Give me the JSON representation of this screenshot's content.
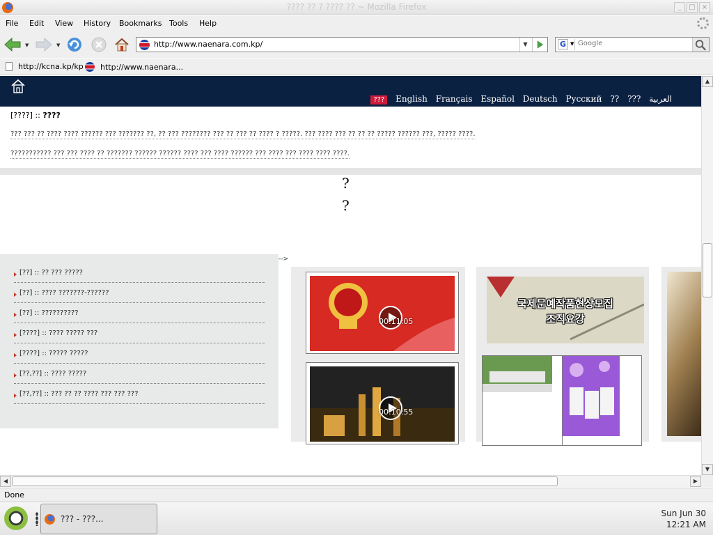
{
  "window": {
    "title": "???? ?? ? ???? ?? ~ Mozilla Firefox"
  },
  "menu": {
    "file": "File",
    "edit": "Edit",
    "view": "View",
    "history": "History",
    "bookmarks": "Bookmarks",
    "tools": "Tools",
    "help": "Help"
  },
  "nav": {
    "url": "http://www.naenara.com.kp/",
    "search_placeholder": "Google",
    "search_engine": "G"
  },
  "bookmarks": [
    {
      "label": "http://kcna.kp/kp"
    },
    {
      "label": "http://www.naenara..."
    }
  ],
  "site": {
    "languages": [
      "???",
      "English",
      "Français",
      "Español",
      "Deutsch",
      "Русский",
      "??",
      "???",
      "العربية"
    ],
    "headline_prefix": "[????] ::",
    "headline_title": "????",
    "para1": "??? ??? ?? ???? ???? ?????? ??? ??????? ??, ?? ??? ???????? ??? ?? ??? ?? ???? ? ?????. ??? ???? ??? ?? ?? ?? ????? ?????? ???, ????? ????.",
    "para2": "??????????? ??? ??? ???? ?? ??????? ?????? ?????? ???? ??? ???? ?????? ??? ???? ??? ???? ???? ????.",
    "qmark1": "?",
    "qmark2": "?",
    "arrow_text": "-->",
    "news": [
      "[??] :: ?? ??? ?????",
      "[??] :: ???? ???????-??????",
      "[??] :: ??????????",
      "[????] :: ???? ????? ???",
      "[????] :: ????? ?????",
      "[??,??] :: ???? ?????",
      "[??,??] :: ??? ?? ?? ???? ??? ??? ???"
    ],
    "videos": [
      {
        "duration": "00:11:05"
      },
      {
        "duration": "00:10:55"
      }
    ],
    "banner_text": [
      "국제문예작품현상모집",
      "조직요강"
    ]
  },
  "status": {
    "text": "Done"
  },
  "taskbar": {
    "task_label": "??? - ???...",
    "clock_day": "Sun Jun 30",
    "clock_time": "12:21 AM"
  },
  "colors": {
    "site_header": "#0a2142",
    "active_lang": "#d01a3c",
    "news_bullet": "#c0392b"
  }
}
